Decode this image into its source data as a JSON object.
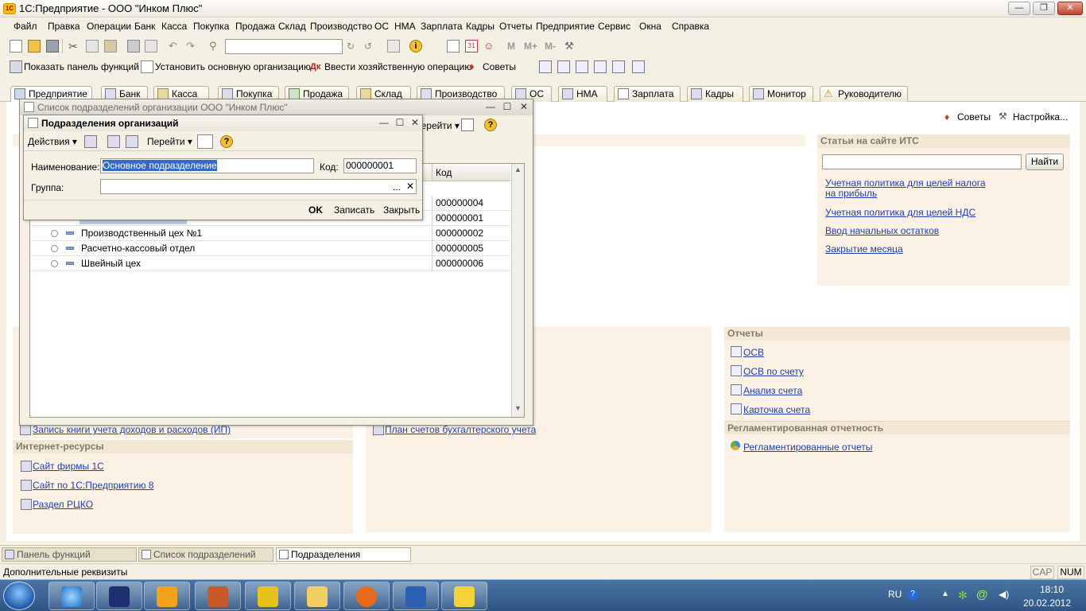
{
  "app": {
    "title": "1С:Предприятие - ООО \"Инком Плюс\"",
    "logo": "1C"
  },
  "window_controls": {
    "minimize": "—",
    "restore": "❐",
    "close": "✕"
  },
  "menu": [
    "Файл",
    "Правка",
    "Операции",
    "Банк",
    "Касса",
    "Покупка",
    "Продажа",
    "Склад",
    "Производство",
    "ОС",
    "НМА",
    "Зарплата",
    "Кадры",
    "Отчеты",
    "Предприятие",
    "Сервис",
    "Окна",
    "Справка"
  ],
  "toolbar2": {
    "show_panel": "Показать панель функций",
    "set_org": "Установить основную организацию",
    "enter_op": "Ввести хозяйственную операцию",
    "tips": "Советы"
  },
  "tabs": [
    "Предприятие",
    "Банк",
    "Касса",
    "Покупка",
    "Продажа",
    "Склад",
    "Производство",
    "ОС",
    "НМА",
    "Зарплата",
    "Кадры",
    "Монитор",
    "Руководителю"
  ],
  "main_right": {
    "tips": "Советы",
    "settings": "Настройка..."
  },
  "its": {
    "title": "Статьи на сайте ИТС",
    "find_button": "Найти",
    "search_value": "",
    "links": [
      "Учетная политика для целей налога на прибыль",
      "Учетная политика для целей НДС",
      "Ввод начальных остатков",
      "Закрытие месяца"
    ],
    "link0_line1": "Учетная политика для целей налога",
    "link0_line2": "на прибыль"
  },
  "reports": {
    "title": "Отчеты",
    "links": [
      "ОСВ",
      "ОСВ по счету",
      "Анализ счета",
      "Карточка счета"
    ]
  },
  "reg_reports": {
    "title": "Регламентированная отчетность",
    "link": "Регламентированные отчеты"
  },
  "internet": {
    "title": "Интернет-ресурсы",
    "links": [
      "Сайт фирмы 1С",
      "Сайт по 1С:Предприятию 8",
      "Раздел РЦКО"
    ]
  },
  "misc_links": {
    "book": "Запись книги учета доходов и расходов (ИП)",
    "chart": "План счетов бухгалтерского учета"
  },
  "list_window": {
    "title": "Список подразделений организации ООО \"Инком Плюс\"",
    "goto": "Перейти",
    "column_code": "Код",
    "rows": [
      {
        "name": "",
        "code": "000000004"
      },
      {
        "name": "",
        "code": "000000001"
      },
      {
        "name": "Производственный цех №1",
        "code": "000000002"
      },
      {
        "name": "Расчетно-кассовый отдел",
        "code": "000000005"
      },
      {
        "name": "Швейный цех",
        "code": "000000006"
      }
    ]
  },
  "form_window": {
    "title": "Подразделения организаций",
    "actions": "Действия",
    "goto": "Перейти",
    "name_label": "Наименование:",
    "name_value": "Основное подразделение",
    "code_label": "Код:",
    "code_value": "000000001",
    "group_label": "Группа:",
    "group_value": "",
    "dots": "...",
    "clear": "✕",
    "ok": "OK",
    "save": "Записать",
    "close": "Закрыть"
  },
  "window_tabs": [
    "Панель функций",
    "Список подразделений орг...",
    "Подразделения организаций"
  ],
  "status": {
    "text": "Дополнительные реквизиты",
    "cap": "CAP",
    "num": "NUM"
  },
  "os_taskbar": {
    "lang": "RU",
    "time": "18:10",
    "date": "20.02.2012"
  },
  "colors": {
    "link": "#1f3fb0",
    "panel_bg": "#fbf2e5",
    "chrome": "#f4f1e4",
    "taskbar": "#2e5586"
  }
}
